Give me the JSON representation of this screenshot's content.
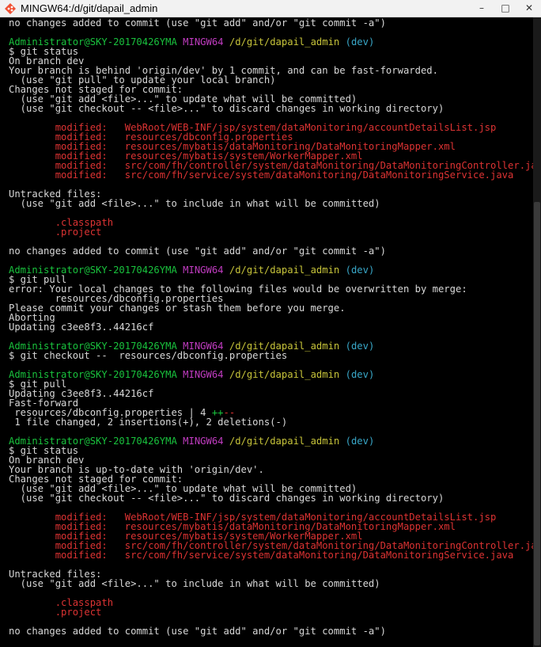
{
  "window": {
    "title": "MINGW64:/d/git/dapail_admin",
    "controls": [
      "–",
      "□",
      "✕"
    ]
  },
  "prompt": {
    "user": "Administrator@SKY-20170426YMA",
    "shell": "MINGW64",
    "path": "/d/git/dapail_admin",
    "branch": "(dev)"
  },
  "lines": [
    {
      "t": "text",
      "v": "no changes added to commit (use \"git add\" and/or \"git commit -a\")"
    },
    {
      "t": "blank"
    },
    {
      "t": "prompt"
    },
    {
      "t": "text",
      "v": "$ git status"
    },
    {
      "t": "text",
      "v": "On branch dev"
    },
    {
      "t": "text",
      "v": "Your branch is behind 'origin/dev' by 1 commit, and can be fast-forwarded."
    },
    {
      "t": "text",
      "v": "  (use \"git pull\" to update your local branch)"
    },
    {
      "t": "text",
      "v": "Changes not staged for commit:"
    },
    {
      "t": "text",
      "v": "  (use \"git add <file>...\" to update what will be committed)"
    },
    {
      "t": "text",
      "v": "  (use \"git checkout -- <file>...\" to discard changes in working directory)"
    },
    {
      "t": "blank"
    },
    {
      "t": "red",
      "v": "        modified:   WebRoot/WEB-INF/jsp/system/dataMonitoring/accountDetailsList.jsp"
    },
    {
      "t": "red",
      "v": "        modified:   resources/dbconfig.properties"
    },
    {
      "t": "red",
      "v": "        modified:   resources/mybatis/dataMonitoring/DataMonitoringMapper.xml"
    },
    {
      "t": "red",
      "v": "        modified:   resources/mybatis/system/WorkerMapper.xml"
    },
    {
      "t": "red",
      "v": "        modified:   src/com/fh/controller/system/dataMonitoring/DataMonitoringController.java"
    },
    {
      "t": "red",
      "v": "        modified:   src/com/fh/service/system/dataMonitoring/DataMonitoringService.java"
    },
    {
      "t": "blank"
    },
    {
      "t": "text",
      "v": "Untracked files:"
    },
    {
      "t": "text",
      "v": "  (use \"git add <file>...\" to include in what will be committed)"
    },
    {
      "t": "blank"
    },
    {
      "t": "red",
      "v": "        .classpath"
    },
    {
      "t": "red",
      "v": "        .project"
    },
    {
      "t": "blank"
    },
    {
      "t": "text",
      "v": "no changes added to commit (use \"git add\" and/or \"git commit -a\")"
    },
    {
      "t": "blank"
    },
    {
      "t": "prompt"
    },
    {
      "t": "text",
      "v": "$ git pull"
    },
    {
      "t": "text",
      "v": "error: Your local changes to the following files would be overwritten by merge:"
    },
    {
      "t": "text",
      "v": "        resources/dbconfig.properties"
    },
    {
      "t": "text",
      "v": "Please commit your changes or stash them before you merge."
    },
    {
      "t": "text",
      "v": "Aborting"
    },
    {
      "t": "text",
      "v": "Updating c3ee8f3..44216cf"
    },
    {
      "t": "blank"
    },
    {
      "t": "prompt"
    },
    {
      "t": "text",
      "v": "$ git checkout --  resources/dbconfig.properties"
    },
    {
      "t": "blank"
    },
    {
      "t": "prompt"
    },
    {
      "t": "text",
      "v": "$ git pull"
    },
    {
      "t": "text",
      "v": "Updating c3ee8f3..44216cf"
    },
    {
      "t": "text",
      "v": "Fast-forward"
    },
    {
      "t": "diffstat",
      "v": " resources/dbconfig.properties | 4 ",
      "plus": "++",
      "minus": "--"
    },
    {
      "t": "text",
      "v": " 1 file changed, 2 insertions(+), 2 deletions(-)"
    },
    {
      "t": "blank"
    },
    {
      "t": "prompt"
    },
    {
      "t": "text",
      "v": "$ git status"
    },
    {
      "t": "text",
      "v": "On branch dev"
    },
    {
      "t": "text",
      "v": "Your branch is up-to-date with 'origin/dev'."
    },
    {
      "t": "text",
      "v": "Changes not staged for commit:"
    },
    {
      "t": "text",
      "v": "  (use \"git add <file>...\" to update what will be committed)"
    },
    {
      "t": "text",
      "v": "  (use \"git checkout -- <file>...\" to discard changes in working directory)"
    },
    {
      "t": "blank"
    },
    {
      "t": "red",
      "v": "        modified:   WebRoot/WEB-INF/jsp/system/dataMonitoring/accountDetailsList.jsp"
    },
    {
      "t": "red",
      "v": "        modified:   resources/mybatis/dataMonitoring/DataMonitoringMapper.xml"
    },
    {
      "t": "red",
      "v": "        modified:   resources/mybatis/system/WorkerMapper.xml"
    },
    {
      "t": "red",
      "v": "        modified:   src/com/fh/controller/system/dataMonitoring/DataMonitoringController.java"
    },
    {
      "t": "red",
      "v": "        modified:   src/com/fh/service/system/dataMonitoring/DataMonitoringService.java"
    },
    {
      "t": "blank"
    },
    {
      "t": "text",
      "v": "Untracked files:"
    },
    {
      "t": "text",
      "v": "  (use \"git add <file>...\" to include in what will be committed)"
    },
    {
      "t": "blank"
    },
    {
      "t": "red",
      "v": "        .classpath"
    },
    {
      "t": "red",
      "v": "        .project"
    },
    {
      "t": "blank"
    },
    {
      "t": "text",
      "v": "no changes added to commit (use \"git add\" and/or \"git commit -a\")"
    }
  ]
}
